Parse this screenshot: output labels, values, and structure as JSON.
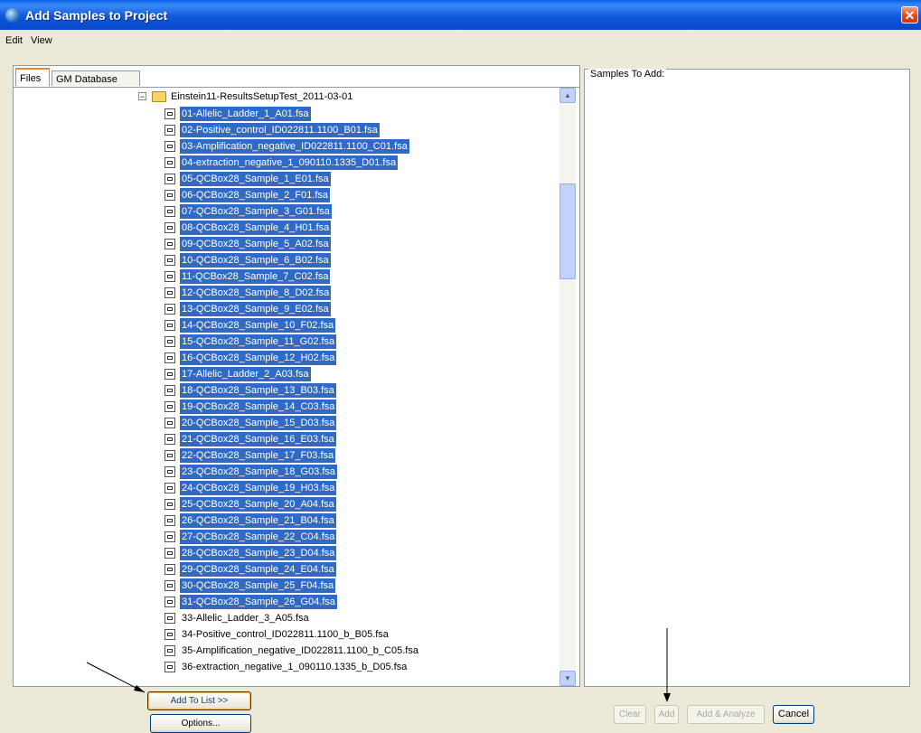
{
  "window": {
    "title": "Add Samples to Project",
    "close_glyph": "✕"
  },
  "menu": [
    {
      "label": "Edit"
    },
    {
      "label": "View"
    }
  ],
  "tabs": [
    {
      "label": "Files"
    },
    {
      "label": "GM Database"
    }
  ],
  "tree": {
    "expander_glyph": "−",
    "folder_label": "Einstein11-ResultsSetupTest_2011-03-01",
    "files": [
      {
        "label": "01-Allelic_Ladder_1_A01.fsa",
        "selected": true
      },
      {
        "label": "02-Positive_control_ID022811.1100_B01.fsa",
        "selected": true
      },
      {
        "label": "03-Amplification_negative_ID022811.1100_C01.fsa",
        "selected": true
      },
      {
        "label": "04-extraction_negative_1_090110.1335_D01.fsa",
        "selected": true
      },
      {
        "label": "05-QCBox28_Sample_1_E01.fsa",
        "selected": true
      },
      {
        "label": "06-QCBox28_Sample_2_F01.fsa",
        "selected": true
      },
      {
        "label": "07-QCBox28_Sample_3_G01.fsa",
        "selected": true
      },
      {
        "label": "08-QCBox28_Sample_4_H01.fsa",
        "selected": true
      },
      {
        "label": "09-QCBox28_Sample_5_A02.fsa",
        "selected": true
      },
      {
        "label": "10-QCBox28_Sample_6_B02.fsa",
        "selected": true
      },
      {
        "label": "11-QCBox28_Sample_7_C02.fsa",
        "selected": true
      },
      {
        "label": "12-QCBox28_Sample_8_D02.fsa",
        "selected": true
      },
      {
        "label": "13-QCBox28_Sample_9_E02.fsa",
        "selected": true
      },
      {
        "label": "14-QCBox28_Sample_10_F02.fsa",
        "selected": true
      },
      {
        "label": "15-QCBox28_Sample_11_G02.fsa",
        "selected": true
      },
      {
        "label": "16-QCBox28_Sample_12_H02.fsa",
        "selected": true
      },
      {
        "label": "17-Allelic_Ladder_2_A03.fsa",
        "selected": true
      },
      {
        "label": "18-QCBox28_Sample_13_B03.fsa",
        "selected": true
      },
      {
        "label": "19-QCBox28_Sample_14_C03.fsa",
        "selected": true
      },
      {
        "label": "20-QCBox28_Sample_15_D03.fsa",
        "selected": true
      },
      {
        "label": "21-QCBox28_Sample_16_E03.fsa",
        "selected": true
      },
      {
        "label": "22-QCBox28_Sample_17_F03.fsa",
        "selected": true
      },
      {
        "label": "23-QCBox28_Sample_18_G03.fsa",
        "selected": true
      },
      {
        "label": "24-QCBox28_Sample_19_H03.fsa",
        "selected": true
      },
      {
        "label": "25-QCBox28_Sample_20_A04.fsa",
        "selected": true
      },
      {
        "label": "26-QCBox28_Sample_21_B04.fsa",
        "selected": true
      },
      {
        "label": "27-QCBox28_Sample_22_C04.fsa",
        "selected": true
      },
      {
        "label": "28-QCBox28_Sample_23_D04.fsa",
        "selected": true
      },
      {
        "label": "29-QCBox28_Sample_24_E04.fsa",
        "selected": true
      },
      {
        "label": "30-QCBox28_Sample_25_F04.fsa",
        "selected": true
      },
      {
        "label": "31-QCBox28_Sample_26_G04.fsa",
        "selected": true
      },
      {
        "label": "33-Allelic_Ladder_3_A05.fsa",
        "selected": false
      },
      {
        "label": "34-Positive_control_ID022811.1100_b_B05.fsa",
        "selected": false
      },
      {
        "label": "35-Amplification_negative_ID022811.1100_b_C05.fsa",
        "selected": false
      },
      {
        "label": "36-extraction_negative_1_090110.1335_b_D05.fsa",
        "selected": false
      }
    ]
  },
  "scrollbar": {
    "up_glyph": "▲",
    "down_glyph": "▼",
    "position_fraction": 0.17
  },
  "right_panel": {
    "legend": "Samples To Add:",
    "items": []
  },
  "buttons": {
    "add_to_list": "Add To List >>",
    "options": "Options...",
    "clear": "Clear",
    "add": "Add",
    "add_analyze": "Add & Analyze",
    "cancel": "Cancel"
  },
  "colors": {
    "selection": "#316ac5",
    "titlebar": "#0a58dc",
    "face": "#ece9d8"
  }
}
